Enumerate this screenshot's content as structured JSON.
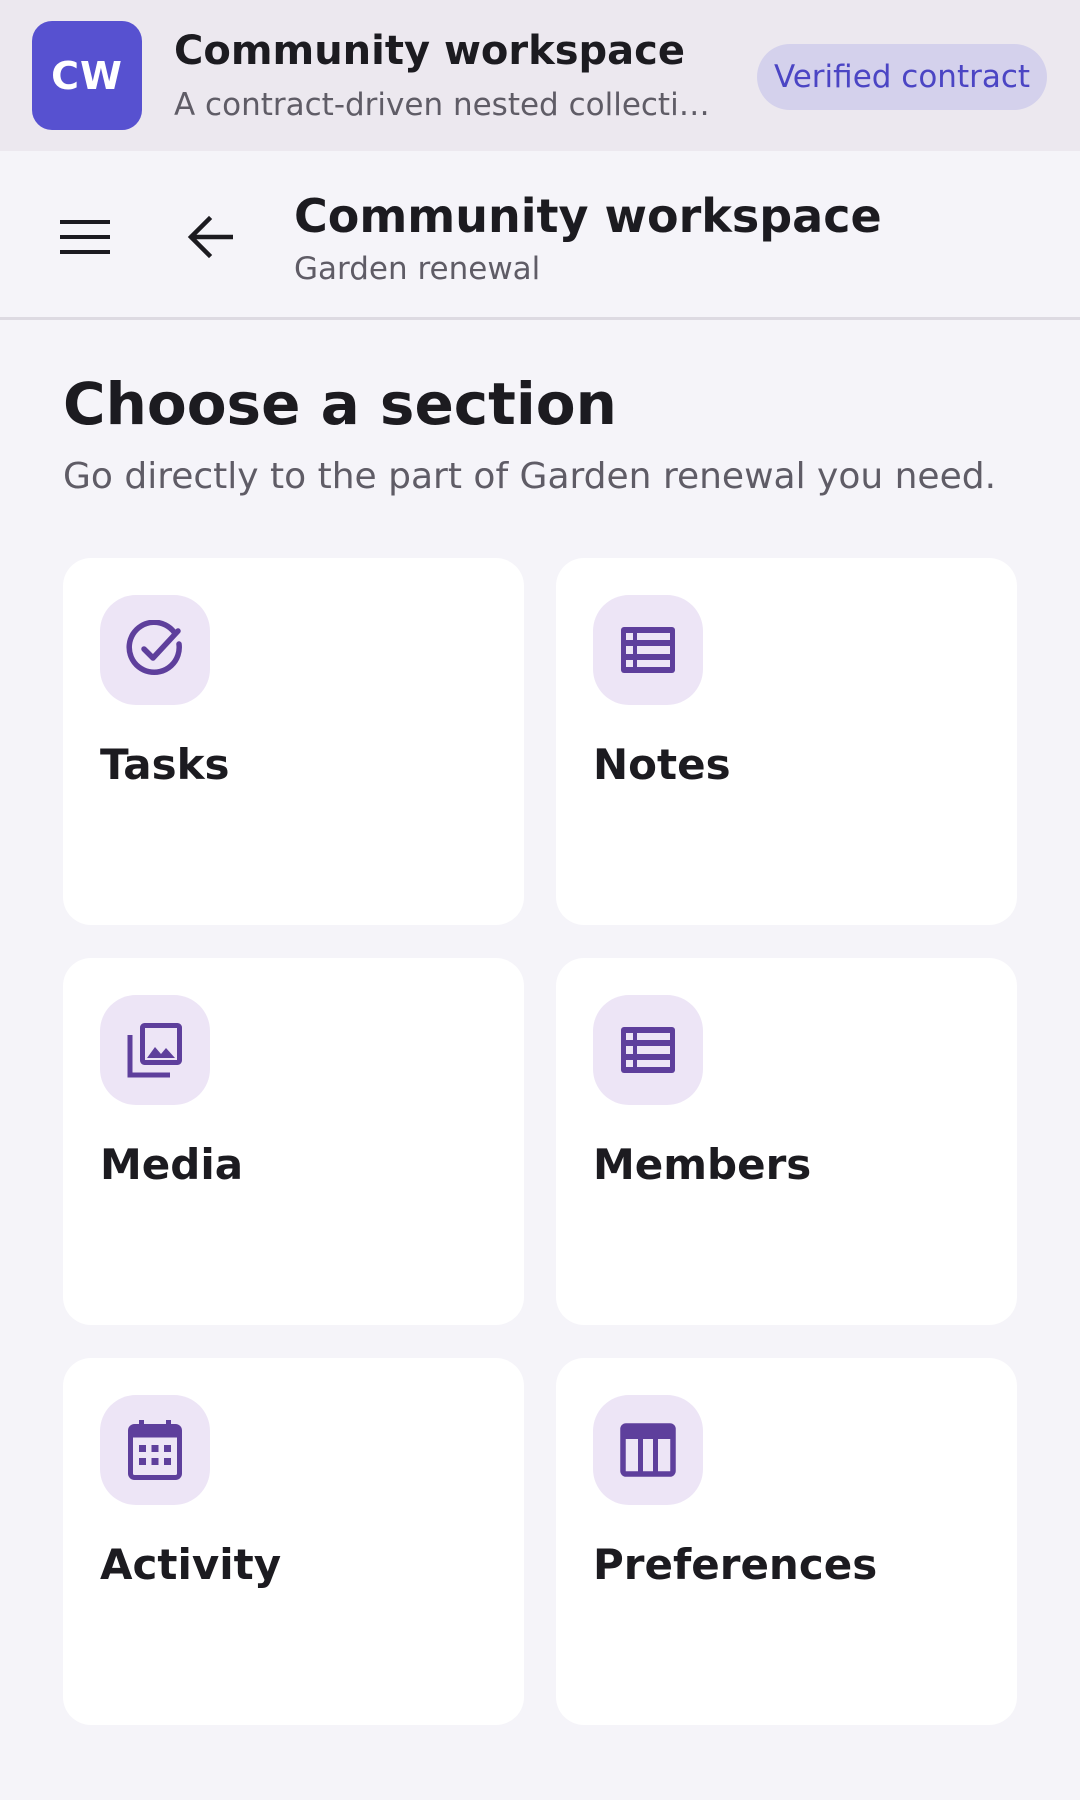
{
  "banner": {
    "avatar_text": "CW",
    "title": "Community workspace",
    "subtitle": "A contract-driven nested collection workspace",
    "badge": "Verified contract"
  },
  "appbar": {
    "menu_icon": "menu-icon",
    "back_icon": "arrow-back-icon",
    "title": "Community workspace",
    "subtitle": "Garden renewal"
  },
  "main": {
    "heading": "Choose a section",
    "description": "Go directly to the part of Garden renewal you need.",
    "sections": [
      {
        "label": "Tasks",
        "icon": "check-circle-icon"
      },
      {
        "label": "Notes",
        "icon": "list-icon"
      },
      {
        "label": "Media",
        "icon": "photo-library-icon"
      },
      {
        "label": "Members",
        "icon": "list-icon"
      },
      {
        "label": "Activity",
        "icon": "calendar-icon"
      },
      {
        "label": "Preferences",
        "icon": "table-icon"
      }
    ]
  },
  "colors": {
    "brand": "#5751d0",
    "icon_accent": "#5e3f9c",
    "icon_tile": "#ede5f6",
    "badge_bg": "#d4d1ec",
    "badge_text": "#4b45c4"
  }
}
